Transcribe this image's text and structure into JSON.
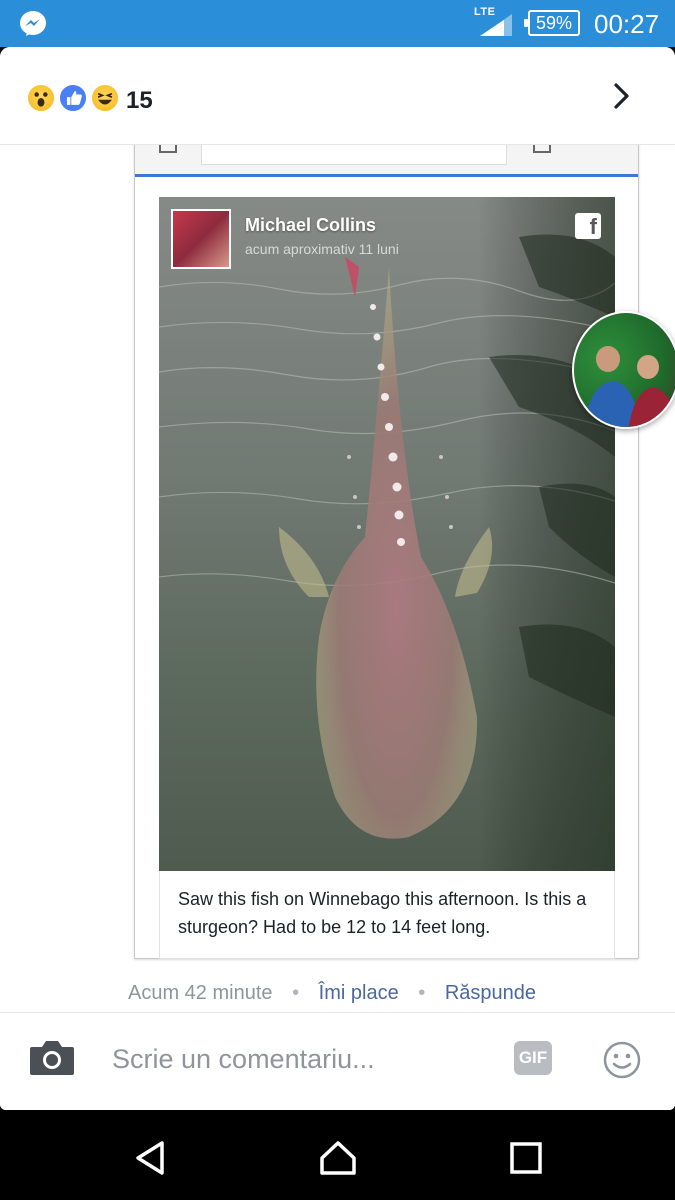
{
  "status_bar": {
    "network": "LTE",
    "battery": "59%",
    "time": "00:27",
    "icons": [
      "messenger-icon",
      "signal-icon",
      "battery-icon"
    ]
  },
  "header": {
    "reactions": [
      "wow",
      "like",
      "haha"
    ],
    "reaction_count": "15"
  },
  "post": {
    "author_name": "Michael Collins",
    "author_time": "acum aproximativ 11 luni",
    "caption": "Saw this fish on Winnebago this afternoon. Is this a sturgeon? Had to be 12 to 14 feet long."
  },
  "comment_meta": {
    "time": "Acum 42 minute",
    "like": "Îmi place",
    "reply": "Răspunde"
  },
  "composer": {
    "placeholder": "Scrie un comentariu...",
    "gif_label": "GIF"
  },
  "colors": {
    "status_bar": "#2b8ed8",
    "link": "#4b67a1",
    "browser_accent": "#3d78d8"
  }
}
